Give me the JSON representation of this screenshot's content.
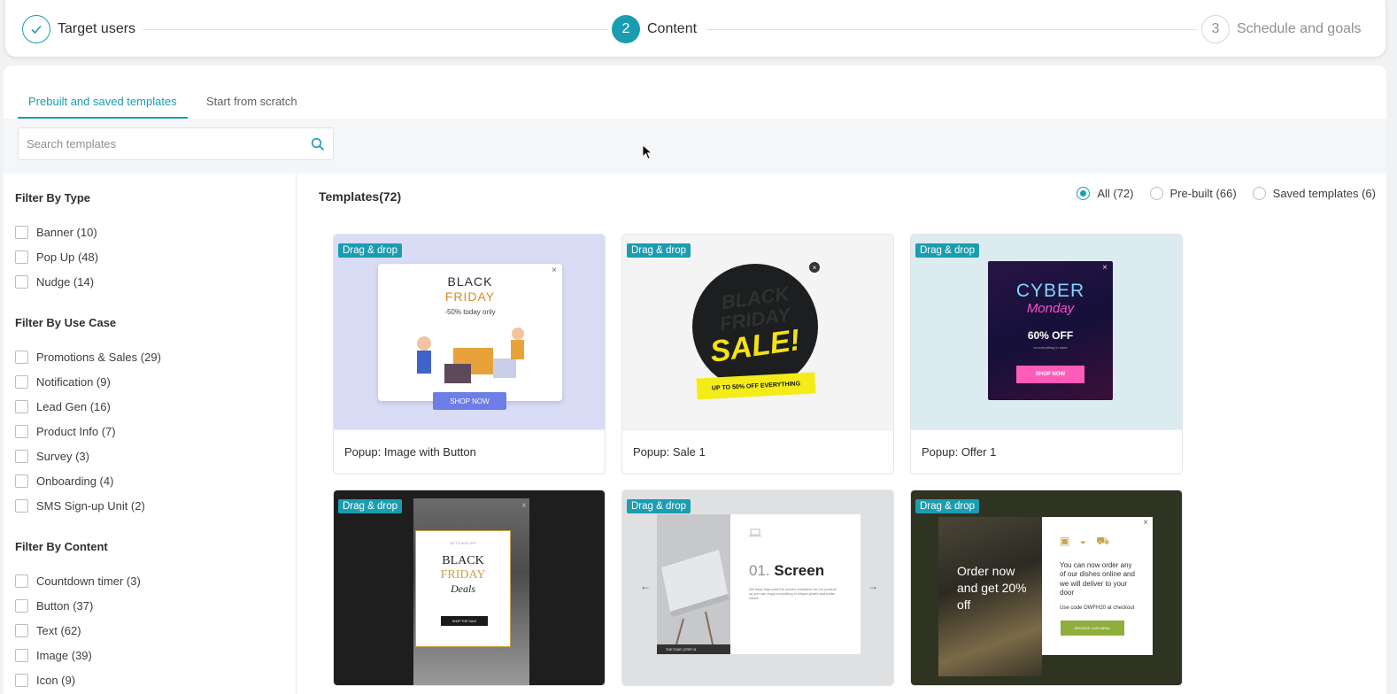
{
  "stepper": {
    "steps": [
      {
        "number": "1",
        "label": "Target users",
        "state": "done"
      },
      {
        "number": "2",
        "label": "Content",
        "state": "active"
      },
      {
        "number": "3",
        "label": "Schedule and goals",
        "state": "todo"
      }
    ]
  },
  "tabs": [
    {
      "label": "Prebuilt and saved templates",
      "active": true
    },
    {
      "label": "Start from scratch",
      "active": false
    }
  ],
  "search": {
    "placeholder": "Search templates",
    "value": ""
  },
  "filters": {
    "type": {
      "title": "Filter By Type",
      "items": [
        "Banner (10)",
        "Pop Up (48)",
        "Nudge (14)"
      ]
    },
    "use_case": {
      "title": "Filter By Use Case",
      "items": [
        "Promotions & Sales (29)",
        "Notification (9)",
        "Lead Gen (16)",
        "Product Info (7)",
        "Survey (3)",
        "Onboarding (4)",
        "SMS Sign-up Unit (2)"
      ]
    },
    "content": {
      "title": "Filter By Content",
      "items": [
        "Countdown timer (3)",
        "Button (37)",
        "Text (62)",
        "Image (39)",
        "Icon (9)"
      ]
    }
  },
  "templates": {
    "title": "Templates(72)",
    "radio_options": [
      {
        "label": "All (72)",
        "selected": true
      },
      {
        "label": "Pre-built (66)",
        "selected": false
      },
      {
        "label": "Saved templates (6)",
        "selected": false
      }
    ],
    "badge": "Drag & drop",
    "cards": [
      {
        "label": "Popup: Image with Button",
        "thumb": {
          "line1": "BLACK",
          "line2": "FRIDAY",
          "line3": "-50% today only",
          "button": "SHOP NOW"
        }
      },
      {
        "label": "Popup: Sale 1",
        "thumb": {
          "line1": "BLACK",
          "line2": "FRIDAY",
          "line3": "SALE!",
          "strip": "UP TO 50% OFF EVERYTHING"
        }
      },
      {
        "label": "Popup: Offer 1",
        "thumb": {
          "line1": "CYBER",
          "line2": "Monday",
          "line3": "60% OFF",
          "sub": "on everything in store",
          "button": "SHOP NOW"
        }
      },
      {
        "label": "",
        "thumb": {
          "line1": "UP TO 50% OFF",
          "line2": "BLACK",
          "line3": "FRIDAY",
          "line4": "Deals",
          "button": "SHOP THE SALE"
        }
      },
      {
        "label": "",
        "thumb": {
          "number": "01.",
          "title": "Screen",
          "para": "We have improved the screen resolution for our product so you can enjoy everything in crisper pixels and better colors.",
          "footer": "THE TOUR | STEP 01"
        }
      },
      {
        "label": "",
        "thumb": {
          "food_text": "Order now and get 20% off",
          "text": "You can now order any of our dishes online and we will deliver to your door",
          "code": "Use code OWFH20 at checkout",
          "button": "BROWSE OUR MENU"
        }
      }
    ]
  },
  "colors": {
    "accent": "#1a9db0"
  }
}
